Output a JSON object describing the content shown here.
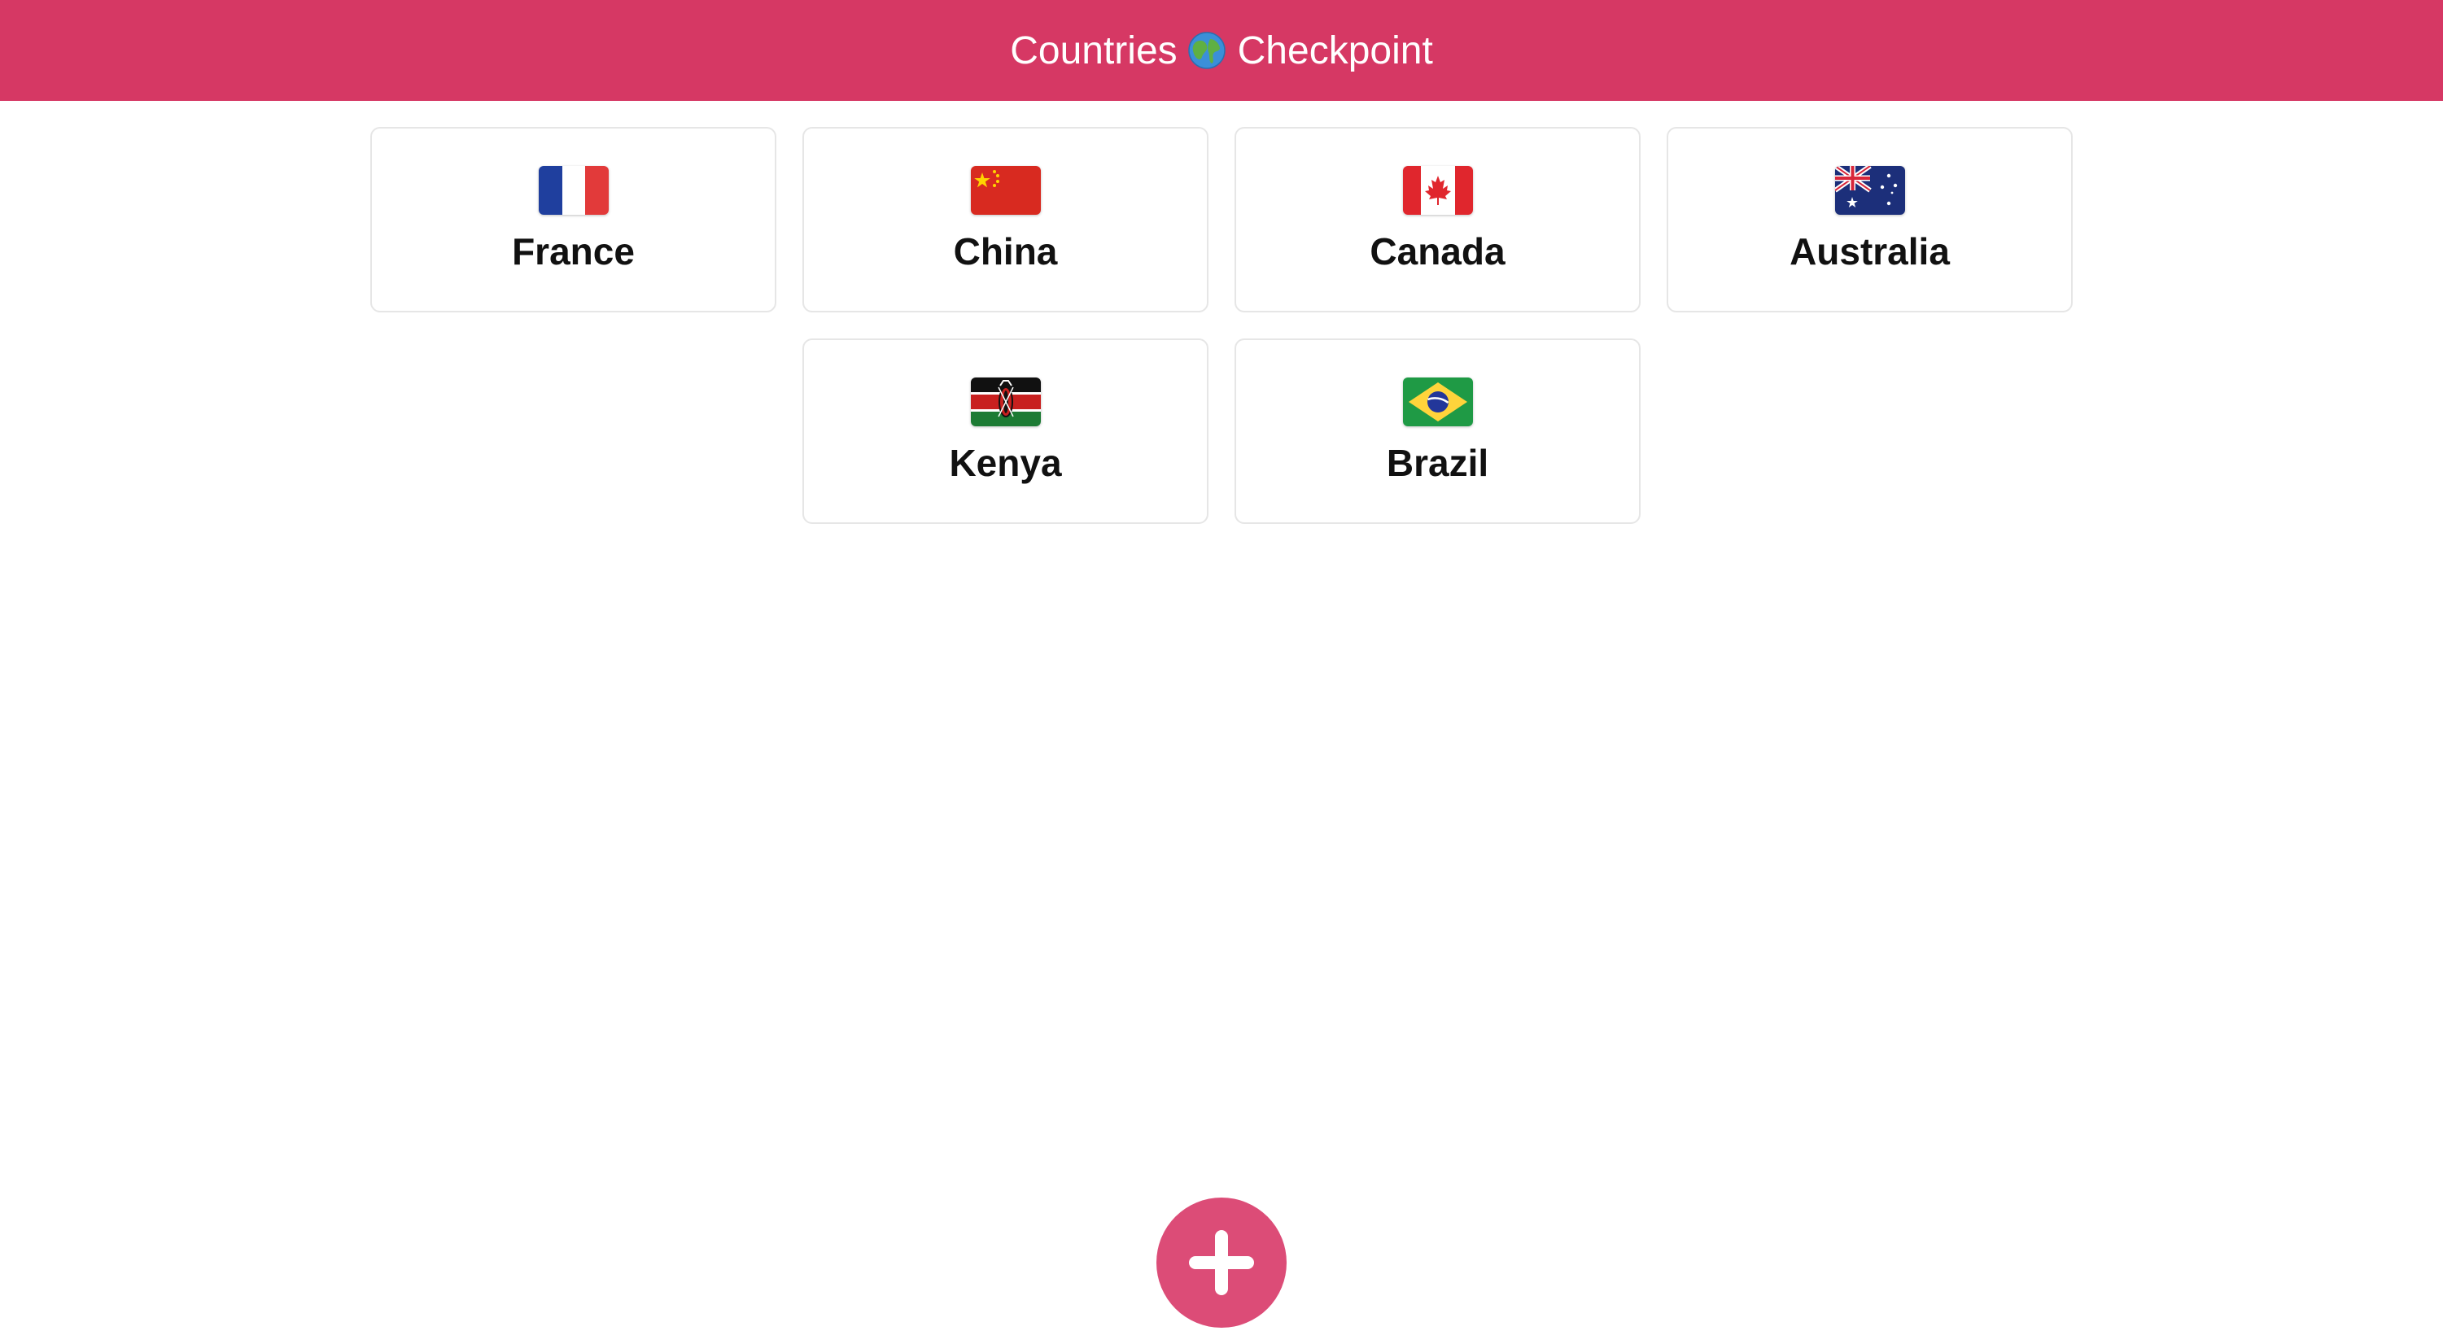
{
  "header": {
    "title_left": "Countries",
    "title_icon": "globe-icon",
    "title_right": "Checkpoint",
    "background": "#d63864"
  },
  "countries": [
    {
      "name": "France",
      "flag_icon": "france-flag-icon"
    },
    {
      "name": "China",
      "flag_icon": "china-flag-icon"
    },
    {
      "name": "Canada",
      "flag_icon": "canada-flag-icon"
    },
    {
      "name": "Australia",
      "flag_icon": "australia-flag-icon"
    },
    {
      "name": "Kenya",
      "flag_icon": "kenya-flag-icon"
    },
    {
      "name": "Brazil",
      "flag_icon": "brazil-flag-icon"
    }
  ],
  "fab": {
    "icon": "plus-icon",
    "color": "#dc4c77"
  }
}
